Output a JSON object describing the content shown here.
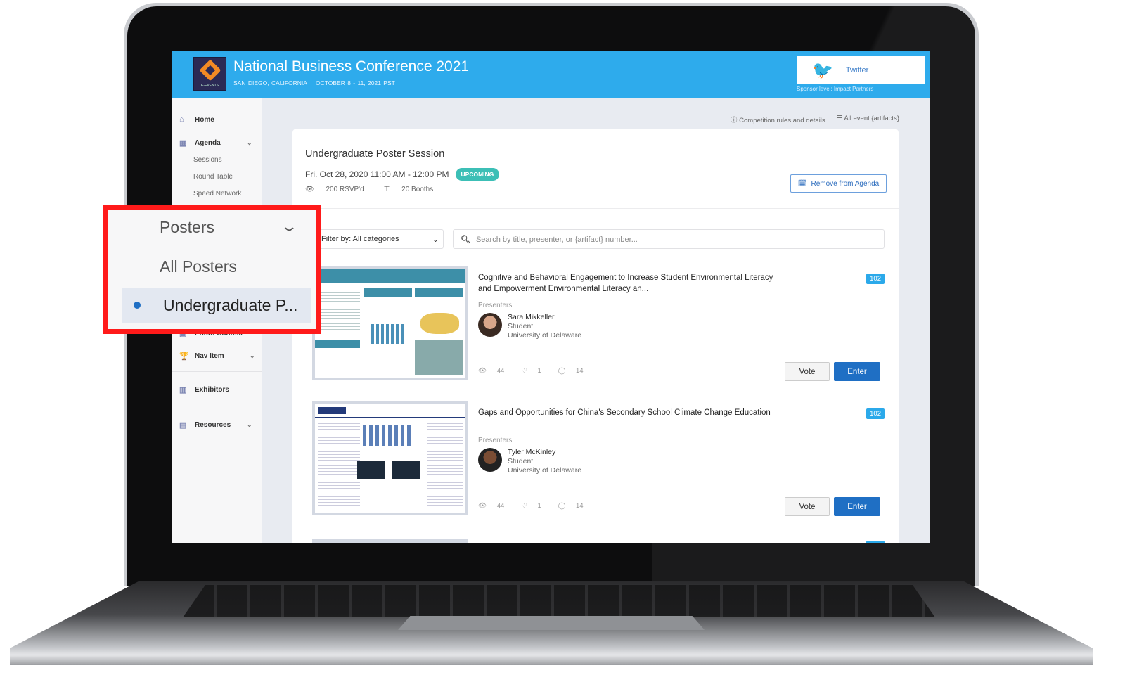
{
  "header": {
    "title": "National Business Conference 2021",
    "location": "SAN DIEGO, CALIFORNIA",
    "dates": "OCTOBER 8 - 11, 2021 PST",
    "logo_text": "E-EVENTS",
    "sponsor_button": "Twitter",
    "sponsor_level": "Sponsor level: Impact Partners"
  },
  "sidebar": {
    "items": [
      {
        "label": "Home",
        "icon": "home-icon"
      },
      {
        "label": "Agenda",
        "icon": "calendar-icon",
        "children": [
          "Sessions",
          "Round Table",
          "Speed Network"
        ]
      },
      {
        "label": "Photo Contest",
        "icon": "camera-icon"
      },
      {
        "label": "Nav Item",
        "icon": "trophy-icon"
      },
      {
        "label": "Exhibitors",
        "icon": "building-icon"
      },
      {
        "label": "Resources",
        "icon": "toolbox-icon"
      }
    ]
  },
  "callout": {
    "section": "Posters",
    "items": [
      "All Posters",
      "Undergraduate P..."
    ],
    "selected": "Undergraduate P..."
  },
  "toplinks": {
    "rules": "Competition rules and details",
    "artifacts": "All event {artifacts}"
  },
  "session": {
    "title": "Undergraduate Poster Session",
    "when": "Fri. Oct 28, 2020 11:00 AM - 12:00 PM",
    "status": "UPCOMING",
    "rsvp": "200 RSVP'd",
    "booths": "20 Booths",
    "remove": "Remove from Agenda"
  },
  "filter": {
    "value": "Filter by: All categories",
    "search_placeholder": "Search by title, presenter, or {artifact} number..."
  },
  "posters": [
    {
      "title": "Cognitive and Behavioral Engagement to Increase Student Environmental Literacy and Empowerment Environmental Literacy an...",
      "number": "102",
      "presenters_label": "Presenters",
      "name": "Sara Mikkeller",
      "role": "Student",
      "org": "University of Delaware",
      "views": "44",
      "likes": "1",
      "comments": "14",
      "vote": "Vote",
      "enter": "Enter"
    },
    {
      "title": "Gaps and Opportunities for China's Secondary School Climate Change Education",
      "number": "102",
      "presenters_label": "Presenters",
      "name": "Tyler McKinley",
      "role": "Student",
      "org": "University of Delaware",
      "views": "44",
      "likes": "1",
      "comments": "14",
      "vote": "Vote",
      "enter": "Enter"
    }
  ],
  "colors": {
    "header": "#2eabec",
    "primary": "#1f6fc4",
    "upcoming": "#3cbfb6",
    "callout_border": "#ff1a1a"
  }
}
